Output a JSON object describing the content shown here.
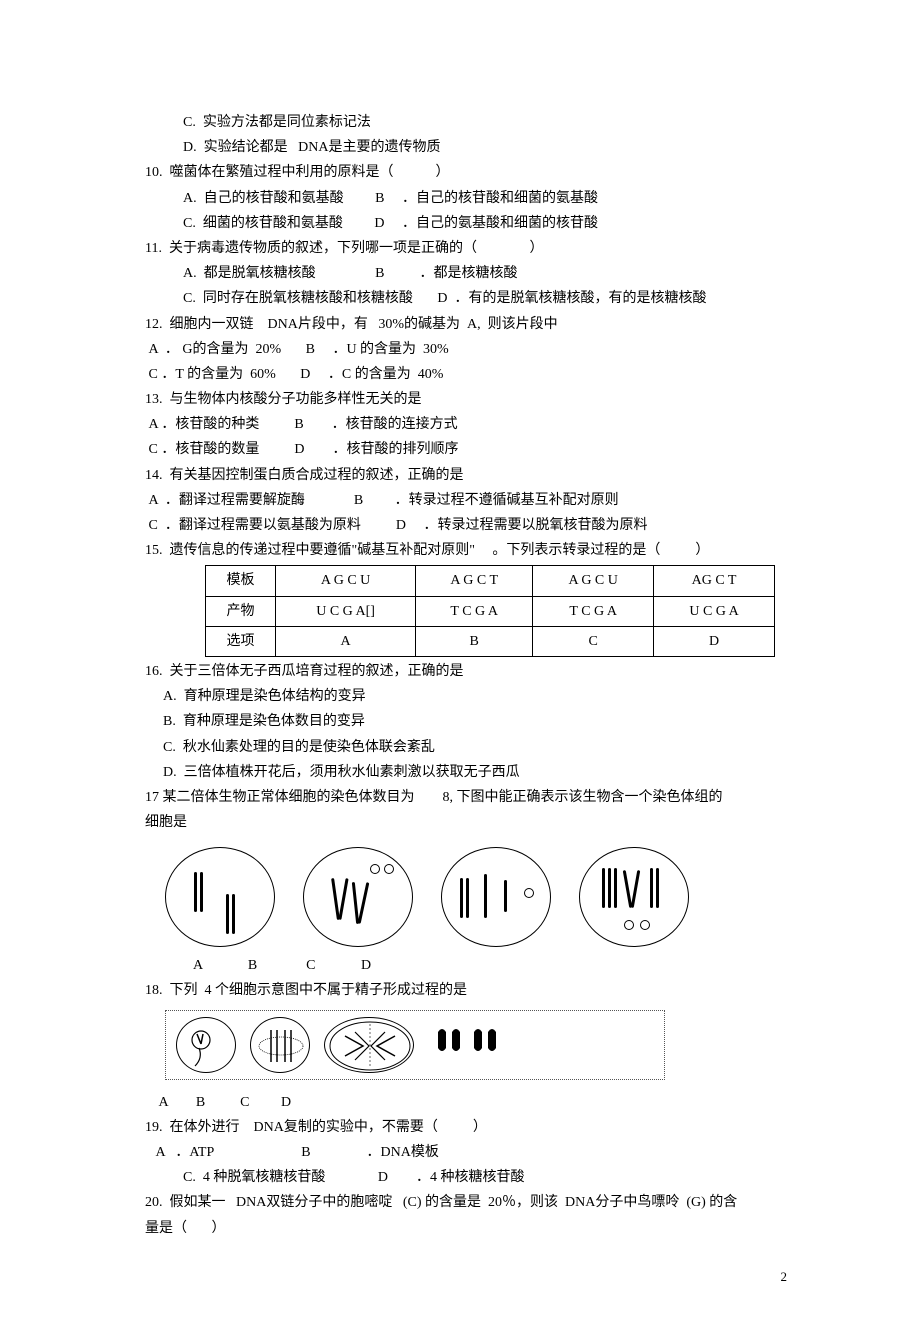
{
  "q9": {
    "c": "C.  实验方法都是同位素标记法",
    "d": "D.  实验结论都是   DNA是主要的遗传物质"
  },
  "q10": {
    "stem": "10.  噬菌体在繁殖过程中利用的原料是（            ）",
    "a": "A.  自己的核苷酸和氨基酸         B     ．自己的核苷酸和细菌的氨基酸",
    "c": "C.  细菌的核苷酸和氨基酸         D     ．自己的氨基酸和细菌的核苷酸"
  },
  "q11": {
    "stem": "11.  关于病毒遗传物质的叙述，下列哪一项是正确的（               ）",
    "a": "A.  都是脱氧核糖核酸                 B          ．都是核糖核酸",
    "c": "C.  同时存在脱氧核糖核酸和核糖核酸       D  ．有的是脱氧核糖核酸，有的是核糖核酸"
  },
  "q12": {
    "stem": "12.  细胞内一双链    DNA片段中，有   30%的碱基为  A,  则该片段中",
    "a": " A  ． G的含量为  20%       B     ．U 的含量为  30%",
    "c": " C ．T 的含量为  60%       D     ．C 的含量为  40%"
  },
  "q13": {
    "stem": "13.  与生物体内核酸分子功能多样性无关的是",
    "a": " A ．核苷酸的种类          B        ．核苷酸的连接方式",
    "c": " C ．核苷酸的数量          D        ．核苷酸的排列顺序"
  },
  "q14": {
    "stem": "14.  有关基因控制蛋白质合成过程的叙述，正确的是",
    "a": " A  ．翻译过程需要解旋酶              B         ．转录过程不遵循碱基互补配对原则",
    "c": " C  ．翻译过程需要以氨基酸为原料          D     ．转录过程需要以脱氧核苷酸为原料"
  },
  "q15": {
    "stem": "15.  遗传信息的传递过程中要遵循\"碱基互补配对原则\"     。下列表示转录过程的是（          ）",
    "table": {
      "r1": [
        "模板",
        "A G C U",
        "A G C T",
        "A G C U",
        "AG C T"
      ],
      "r2": [
        "产物",
        "U C G A[]",
        "T C G A",
        "T C G A",
        "U C G A"
      ],
      "r3": [
        "选项",
        "A",
        "B",
        "C",
        "D"
      ]
    }
  },
  "q16": {
    "stem": "16.  关于三倍体无子西瓜培育过程的叙述，正确的是",
    "a": "A.  育种原理是染色体结构的变异",
    "b": "B.  育种原理是染色体数目的变异",
    "c": "C.  秋水仙素处理的目的是使染色体联会紊乱",
    "d": "D.  三倍体植株开花后，须用秋水仙素刺激以获取无子西瓜"
  },
  "q17": {
    "stem1": "17 某二倍体生物正常体细胞的染色体数目为        8, 下图中能正确表示该生物含一个染色体组的",
    "stem2": "细胞是",
    "opts": "A             B              C             D"
  },
  "q18": {
    "stem": "18.  下列  4 个细胞示意图中不属于精子形成过程的是",
    "opts": " A        B          C         D"
  },
  "q19": {
    "stem": "19.  在体外进行    DNA复制的实验中，不需要（          ）",
    "a": "   A   ．ATP                         B                ．DNA模板",
    "c": "C.  4 种脱氧核糖核苷酸               D        ．4 种核糖核苷酸"
  },
  "q20": {
    "stem1": "20.  假如某一   DNA双链分子中的胞嘧啶   (C) 的含量是  20％，则该  DNA分子中鸟嘌呤  (G) 的含",
    "stem2": "量是（       ）"
  },
  "page": "2"
}
